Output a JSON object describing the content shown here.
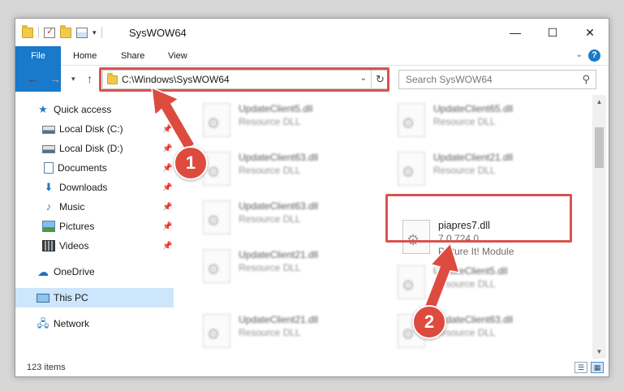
{
  "window": {
    "title": "SysWOW64"
  },
  "ribbon": {
    "tabs": [
      "File",
      "Home",
      "Share",
      "View"
    ],
    "help": "?"
  },
  "nav": {
    "address": "C:\\Windows\\SysWOW64",
    "search_placeholder": "Search SysWOW64"
  },
  "sidebar": {
    "items": [
      {
        "label": "Quick access",
        "icon": "star-icon"
      },
      {
        "label": "Local Disk (C:)",
        "icon": "disk-icon",
        "pinned": true
      },
      {
        "label": "Local Disk (D:)",
        "icon": "disk-icon",
        "pinned": true
      },
      {
        "label": "Documents",
        "icon": "documents-icon",
        "pinned": true
      },
      {
        "label": "Downloads",
        "icon": "downloads-icon",
        "pinned": true
      },
      {
        "label": "Music",
        "icon": "music-icon",
        "pinned": true
      },
      {
        "label": "Pictures",
        "icon": "pictures-icon",
        "pinned": true
      },
      {
        "label": "Videos",
        "icon": "videos-icon",
        "pinned": true
      },
      {
        "label": "OneDrive",
        "icon": "onedrive-icon"
      },
      {
        "label": "This PC",
        "icon": "pc-icon",
        "selected": true
      },
      {
        "label": "Network",
        "icon": "network-icon"
      }
    ]
  },
  "files": [
    {
      "name": "UpdateClient5.dll",
      "meta1": "Resource DLL",
      "meta2": ""
    },
    {
      "name": "UpdateClient65.dll",
      "meta1": "Resource DLL",
      "meta2": ""
    },
    {
      "name": "UpdateClient63.dll",
      "meta1": "Resource DLL",
      "meta2": ""
    },
    {
      "name": "UpdateClient21.dll",
      "meta1": "Resource DLL",
      "meta2": ""
    },
    {
      "name": "UpdateClient63.dll",
      "meta1": "Resource DLL",
      "meta2": ""
    },
    {
      "name": "piapres7.dll",
      "meta1": "7.0.724.0",
      "meta2": "Picture It! Module"
    },
    {
      "name": "UpdateClient21.dll",
      "meta1": "Resource DLL",
      "meta2": ""
    },
    {
      "name": "UpdateClient5.dll",
      "meta1": "Resource DLL",
      "meta2": ""
    },
    {
      "name": "UpdateClient21.dll",
      "meta1": "Resource DLL",
      "meta2": ""
    },
    {
      "name": "UpdateClient63.dll",
      "meta1": "Resource DLL",
      "meta2": ""
    }
  ],
  "status": {
    "item_count": "123 items"
  },
  "annotations": {
    "step1": "1",
    "step2": "2",
    "color": "#dd4b3f"
  }
}
